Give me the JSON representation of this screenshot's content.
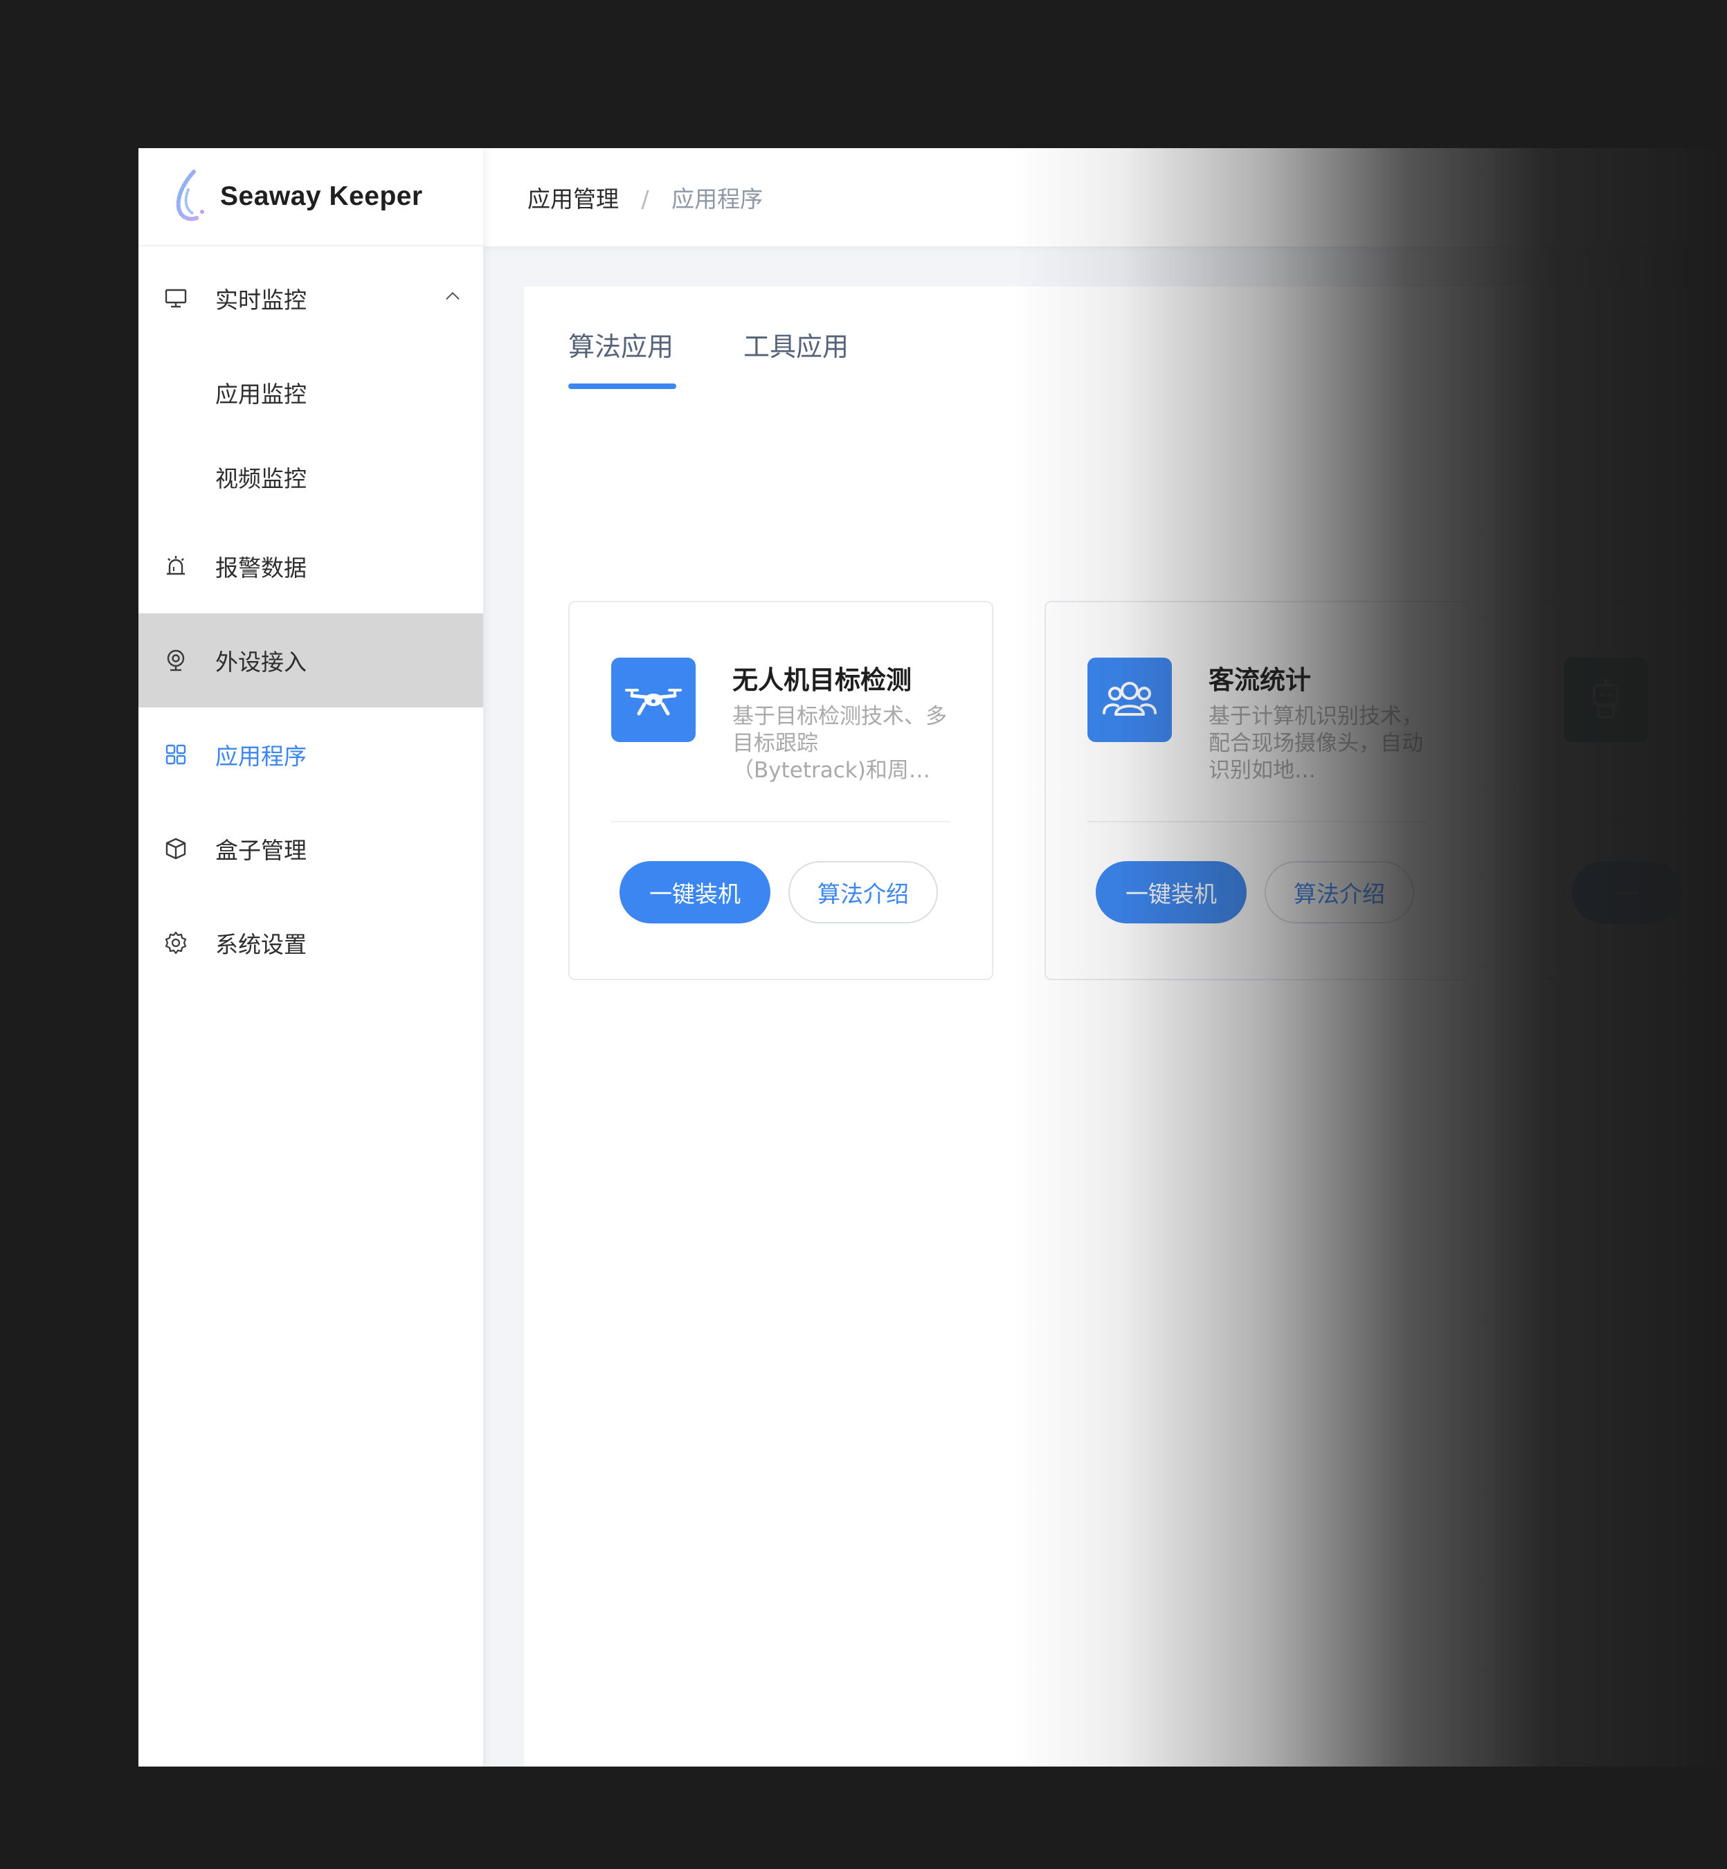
{
  "app": {
    "name": "Seaway Keeper",
    "accent_color": "#3b86f0",
    "logo_icon": "droplet-logo-icon"
  },
  "sidebar": {
    "items": [
      {
        "label": "实时监控",
        "icon": "monitor-icon",
        "expanded": true
      },
      {
        "label": "应用监控",
        "icon": ""
      },
      {
        "label": "视频监控",
        "icon": ""
      },
      {
        "label": "报警数据",
        "icon": "alarm-icon"
      },
      {
        "label": "外设接入",
        "icon": "webcam-icon",
        "highlighted": true
      },
      {
        "label": "应用程序",
        "icon": "grid-icon",
        "current": true
      },
      {
        "label": "盒子管理",
        "icon": "box-icon"
      },
      {
        "label": "系统设置",
        "icon": "gear-icon"
      }
    ]
  },
  "breadcrumb": {
    "parent": "应用管理",
    "separator": "/",
    "current": "应用程序"
  },
  "tabs": {
    "algo": "算法应用",
    "tool": "工具应用",
    "active": "算法应用"
  },
  "cards": [
    {
      "title": "无人机目标检测",
      "description": "基于目标检测技术、多目标跟踪（Bytetrack)和周…",
      "icon": "drone-icon",
      "install_label": "一键装机",
      "intro_label": "算法介绍"
    },
    {
      "title": "客流统计",
      "description": "基于计算机识别技术，配合现场摄像头，自动识别如地…",
      "icon": "people-icon",
      "install_label": "一键装机",
      "intro_label": "算法介绍"
    },
    {
      "title": "",
      "description": "",
      "icon": "robot-icon",
      "install_label": "一",
      "intro_label": ""
    }
  ]
}
